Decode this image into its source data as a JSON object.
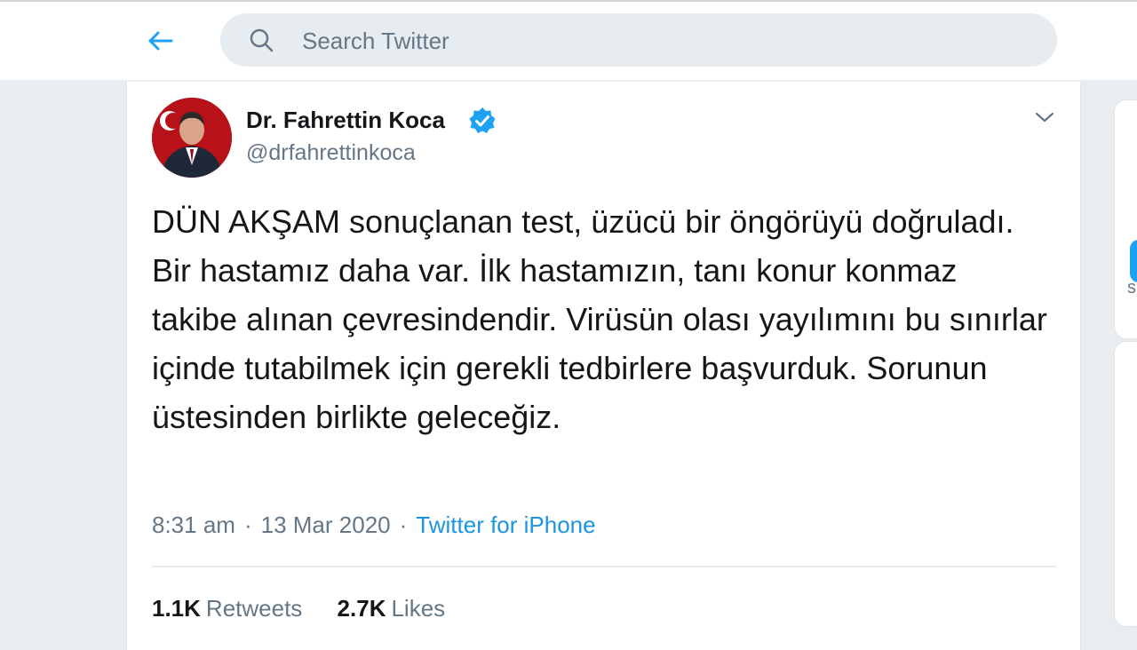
{
  "search": {
    "placeholder": "Search Twitter"
  },
  "tweet": {
    "author_name": "Dr. Fahrettin Koca",
    "handle": "@drfahrettinkoca",
    "text": "DÜN AKŞAM sonuçlanan test, üzücü bir öngörüyü doğruladı. Bir hastamız daha var. İlk hastamızın, tanı konur konmaz takibe alınan çevresindendir. Virüsün olası yayılımını bu sınırlar içinde tutabilmek için gerekli tedbirlere başvurduk. Sorunun üstesinden birlikte geleceğiz.",
    "time": "8:31 am",
    "separator": "·",
    "date": "13 Mar 2020",
    "source": "Twitter for iPhone",
    "retweets_count": "1.1K",
    "retweets_label": "Retweets",
    "likes_count": "2.7K",
    "likes_label": "Likes"
  },
  "colors": {
    "accent": "#1da1f2",
    "link": "#1b95e0",
    "text": "#14171a",
    "secondary": "#657786"
  },
  "icons": [
    "back-arrow-icon",
    "search-icon",
    "verified-badge-icon",
    "chevron-down-icon"
  ]
}
